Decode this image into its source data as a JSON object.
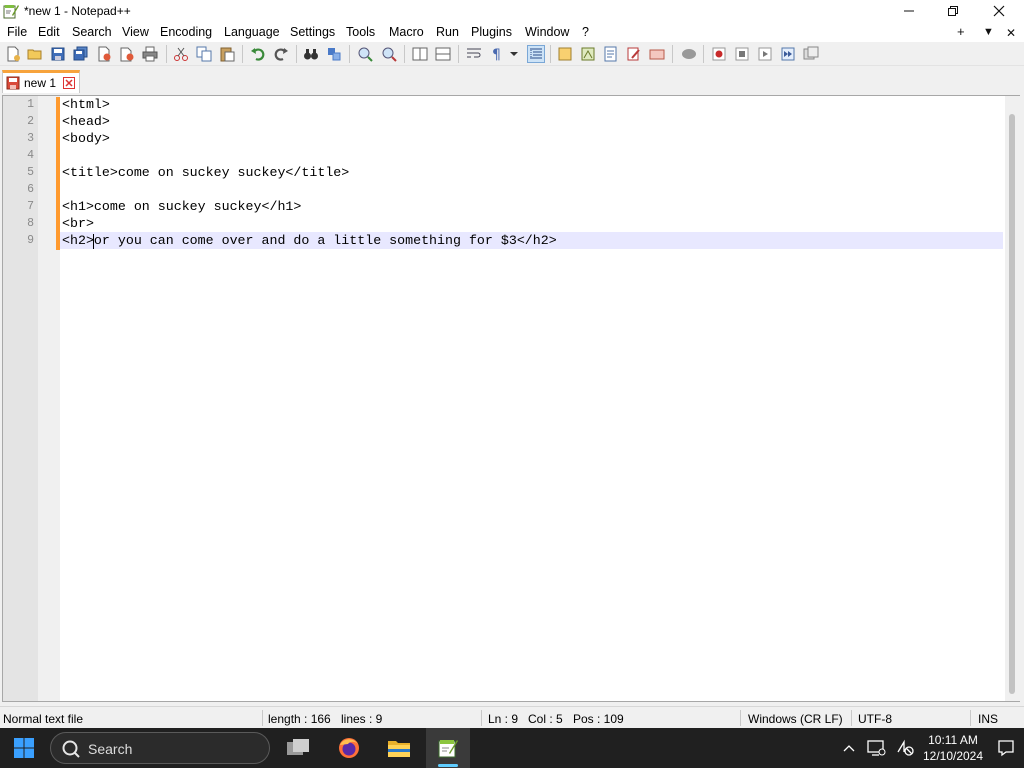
{
  "window": {
    "title": "*new 1 - Notepad++"
  },
  "menu": [
    "File",
    "Edit",
    "Search",
    "View",
    "Encoding",
    "Language",
    "Settings",
    "Tools",
    "Macro",
    "Run",
    "Plugins",
    "Window",
    "?"
  ],
  "menu_right": {
    "plus": "+",
    "dropdown": "▼",
    "close": "✕"
  },
  "tab": {
    "label": "new 1"
  },
  "editor": {
    "lines": [
      "<html>",
      "<head>",
      "<body>",
      "",
      "<title>come on suckey suckey</title>",
      "",
      "<h1>come on suckey suckey</h1>",
      "<br>",
      "<h2>or you can come over and do a little something for $3</h2>"
    ],
    "current_line": 9
  },
  "status": {
    "file_type": "Normal text file",
    "length": "length : 166",
    "lines": "lines : 9",
    "ln": "Ln : 9",
    "col": "Col : 5",
    "pos": "Pos : 109",
    "eol": "Windows (CR LF)",
    "encoding": "UTF-8",
    "mode": "INS"
  },
  "taskbar": {
    "search_placeholder": "Search",
    "time": "10:11 AM",
    "date": "12/10/2024"
  },
  "icons": {
    "app": "notepadpp-icon",
    "start": "windows-start-icon",
    "search": "search-icon",
    "task_view": "task-view-icon",
    "firefox": "firefox-icon",
    "explorer": "file-explorer-icon",
    "notepadpp_task": "notepadpp-taskbar-icon"
  },
  "colors": {
    "change_bar": "#ff9a2e",
    "current_line": "#e8e8ff",
    "taskbar": "#202020",
    "active_indicator": "#60cdff"
  }
}
